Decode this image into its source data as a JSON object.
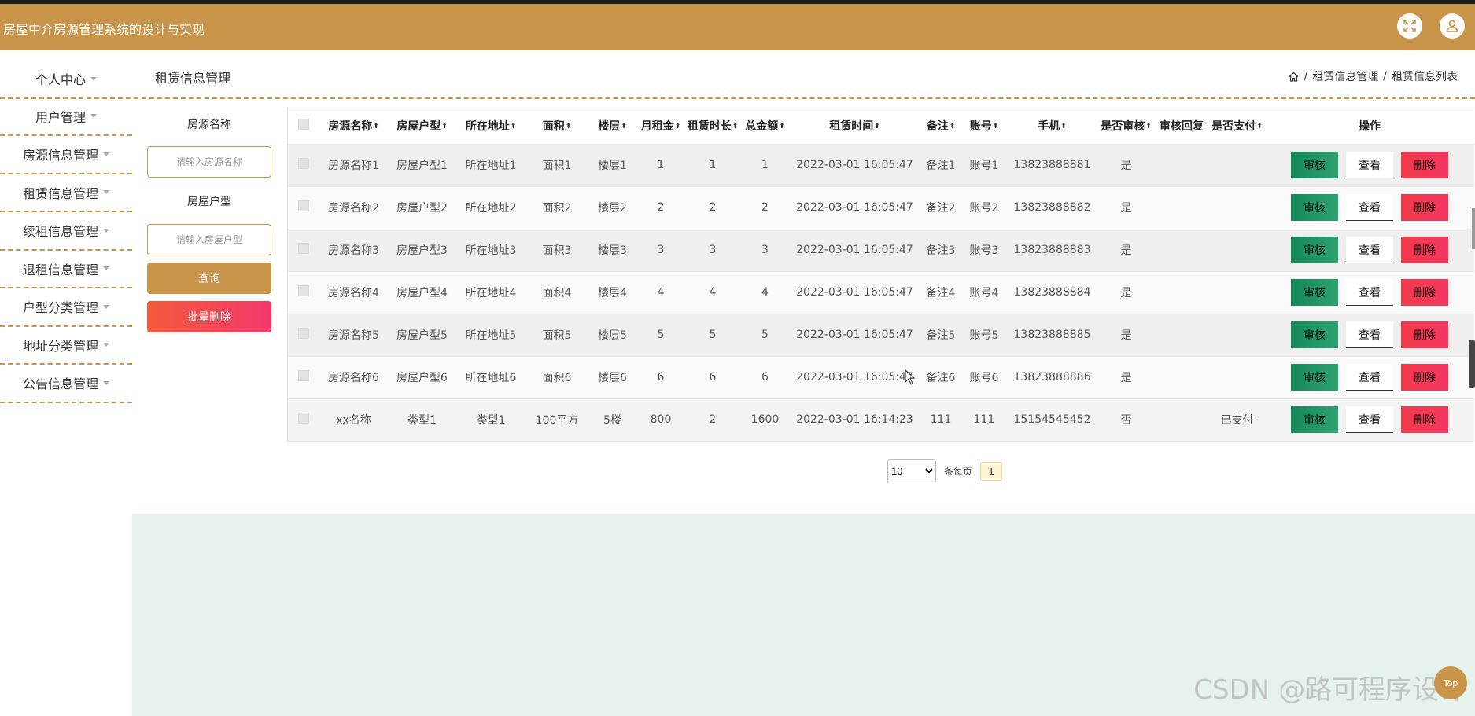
{
  "app": {
    "title": "房屋中介房源管理系统的设计与实现"
  },
  "header": {
    "icons": [
      "fullscreen-icon",
      "user-icon"
    ]
  },
  "sidebar": {
    "items": [
      {
        "label": "个人中心"
      },
      {
        "label": "用户管理"
      },
      {
        "label": "房源信息管理"
      },
      {
        "label": "租赁信息管理"
      },
      {
        "label": "续租信息管理"
      },
      {
        "label": "退租信息管理"
      },
      {
        "label": "户型分类管理"
      },
      {
        "label": "地址分类管理"
      },
      {
        "label": "公告信息管理"
      }
    ]
  },
  "page": {
    "title": "租赁信息管理",
    "breadcrumb": {
      "sep": "/",
      "level1": "租赁信息管理",
      "level2": "租赁信息列表"
    }
  },
  "filters": {
    "name_label": "房源名称",
    "name_placeholder": "请输入房源名称",
    "type_label": "房屋户型",
    "type_placeholder": "请输入房屋户型",
    "query_label": "查询",
    "batch_delete_label": "批量删除"
  },
  "table": {
    "columns": {
      "name": "房源名称",
      "type": "房屋户型",
      "address": "所在地址",
      "area": "面积",
      "floor": "楼层",
      "rent": "月租金",
      "duration": "租赁时长",
      "total": "总金额",
      "time": "租赁时间",
      "note": "备注",
      "account": "账号",
      "phone": "手机",
      "audited": "是否审核",
      "reply": "审核回复",
      "paid": "是否支付",
      "ops": "操作"
    },
    "sort_glyph": "⬍",
    "buttons": {
      "audit": "审核",
      "view": "查看",
      "delete": "删除"
    },
    "rows": [
      {
        "name": "房源名称1",
        "type": "房屋户型1",
        "address": "所在地址1",
        "area": "面积1",
        "floor": "楼层1",
        "rent": "1",
        "duration": "1",
        "total": "1",
        "time": "2022-03-01 16:05:47",
        "note": "备注1",
        "account": "账号1",
        "phone": "13823888881",
        "audited": "是",
        "reply": "",
        "paid": ""
      },
      {
        "name": "房源名称2",
        "type": "房屋户型2",
        "address": "所在地址2",
        "area": "面积2",
        "floor": "楼层2",
        "rent": "2",
        "duration": "2",
        "total": "2",
        "time": "2022-03-01 16:05:47",
        "note": "备注2",
        "account": "账号2",
        "phone": "13823888882",
        "audited": "是",
        "reply": "",
        "paid": ""
      },
      {
        "name": "房源名称3",
        "type": "房屋户型3",
        "address": "所在地址3",
        "area": "面积3",
        "floor": "楼层3",
        "rent": "3",
        "duration": "3",
        "total": "3",
        "time": "2022-03-01 16:05:47",
        "note": "备注3",
        "account": "账号3",
        "phone": "13823888883",
        "audited": "是",
        "reply": "",
        "paid": ""
      },
      {
        "name": "房源名称4",
        "type": "房屋户型4",
        "address": "所在地址4",
        "area": "面积4",
        "floor": "楼层4",
        "rent": "4",
        "duration": "4",
        "total": "4",
        "time": "2022-03-01 16:05:47",
        "note": "备注4",
        "account": "账号4",
        "phone": "13823888884",
        "audited": "是",
        "reply": "",
        "paid": ""
      },
      {
        "name": "房源名称5",
        "type": "房屋户型5",
        "address": "所在地址5",
        "area": "面积5",
        "floor": "楼层5",
        "rent": "5",
        "duration": "5",
        "total": "5",
        "time": "2022-03-01 16:05:47",
        "note": "备注5",
        "account": "账号5",
        "phone": "13823888885",
        "audited": "是",
        "reply": "",
        "paid": ""
      },
      {
        "name": "房源名称6",
        "type": "房屋户型6",
        "address": "所在地址6",
        "area": "面积6",
        "floor": "楼层6",
        "rent": "6",
        "duration": "6",
        "total": "6",
        "time": "2022-03-01 16:05:47",
        "note": "备注6",
        "account": "账号6",
        "phone": "13823888886",
        "audited": "是",
        "reply": "",
        "paid": ""
      },
      {
        "name": "xx名称",
        "type": "类型1",
        "address": "类型1",
        "area": "100平方",
        "floor": "5楼",
        "rent": "800",
        "duration": "2",
        "total": "1600",
        "time": "2022-03-01 16:14:23",
        "note": "111",
        "account": "111",
        "phone": "15154545452",
        "audited": "否",
        "reply": "",
        "paid": "已支付"
      }
    ]
  },
  "pagination": {
    "page_size": "10",
    "per_page_label": "条每页",
    "current_page": "1"
  },
  "watermark": "CSDN @路可程序设计",
  "float_button": "Top"
}
